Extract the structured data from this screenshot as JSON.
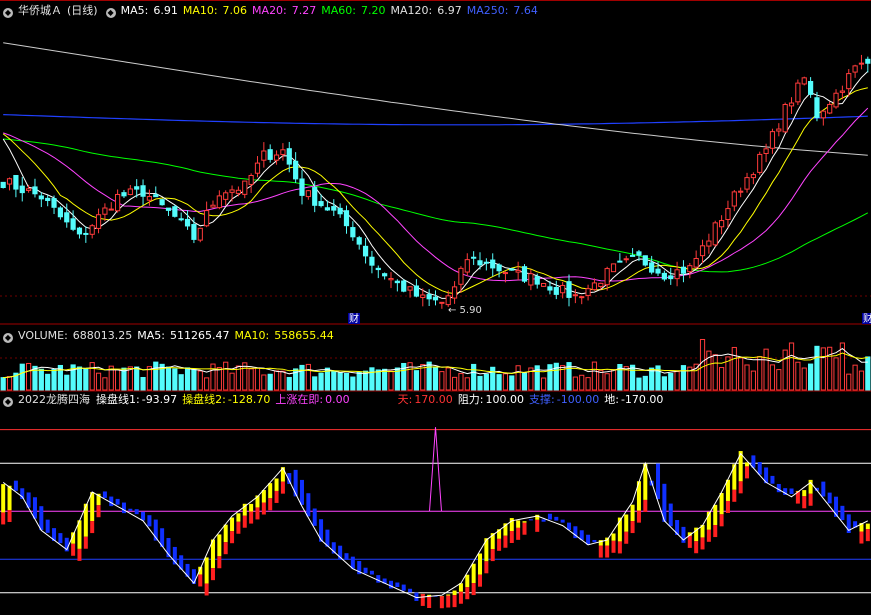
{
  "chart_data": [
    {
      "type": "candlestick",
      "panel": "price",
      "legend": [
        {
          "label": "华侨城Ａ",
          "value": "(日线)",
          "color": "#e6e6e6"
        },
        {
          "label": "MA5:",
          "value": "6.91",
          "color": "#ffffff"
        },
        {
          "label": "MA10:",
          "value": "7.06",
          "color": "#ffff00"
        },
        {
          "label": "MA20:",
          "value": "7.27",
          "color": "#ff44ff"
        },
        {
          "label": "MA60:",
          "value": "7.20",
          "color": "#00ff00"
        },
        {
          "label": "MA120:",
          "value": "6.97",
          "color": "#e0e0e0"
        },
        {
          "label": "MA250:",
          "value": "7.64",
          "color": "#4060ff"
        }
      ],
      "ylim": [
        5.75,
        8.7
      ],
      "low_annotation": "5.90",
      "markers": [
        "财",
        "财"
      ],
      "ma_colors": {
        "MA5": "#ffffff",
        "MA10": "#ffff00",
        "MA20": "#ff44ff",
        "MA60": "#00ff00",
        "MA120": "#cccccc",
        "MA250": "#2040ff"
      },
      "up_color": "#ff3b3b",
      "down_color": "#54fcfc"
    },
    {
      "type": "bar",
      "panel": "volume",
      "legend": [
        {
          "label": "VOLUME:",
          "value": "688013.25",
          "color": "#e0e0e0"
        },
        {
          "label": "MA5:",
          "value": "511265.47",
          "color": "#ffffff"
        },
        {
          "label": "MA10:",
          "value": "558655.44",
          "color": "#ffff00"
        }
      ]
    },
    {
      "type": "bar",
      "panel": "indicator",
      "legend": [
        {
          "label": "2022龙腾四海",
          "value": "",
          "color": "#e0e0e0"
        },
        {
          "label": "操盘线1:",
          "value": "-93.97",
          "color": "#ffffff"
        },
        {
          "label": "操盘线2:",
          "value": "-128.70",
          "color": "#ffff00"
        },
        {
          "label": "上涨在即:",
          "value": "0.00",
          "color": "#ff44ff"
        },
        {
          "label": "天:",
          "value": "170.00",
          "color": "#ff3030"
        },
        {
          "label": "阻力:",
          "value": "100.00",
          "color": "#ffffff"
        },
        {
          "label": "支撑:",
          "value": "-100.00",
          "color": "#2040ff"
        },
        {
          "label": "地:",
          "value": "-170.00",
          "color": "#ffffff"
        }
      ],
      "levels": [
        {
          "value": 170,
          "color": "#ff3030"
        },
        {
          "value": 100,
          "color": "#ffffff"
        },
        {
          "value": 0,
          "color": "#ff44ff"
        },
        {
          "value": -100,
          "color": "#2040ff"
        },
        {
          "value": -170,
          "color": "#ffffff"
        }
      ],
      "ylim": [
        -210,
        215
      ]
    }
  ]
}
